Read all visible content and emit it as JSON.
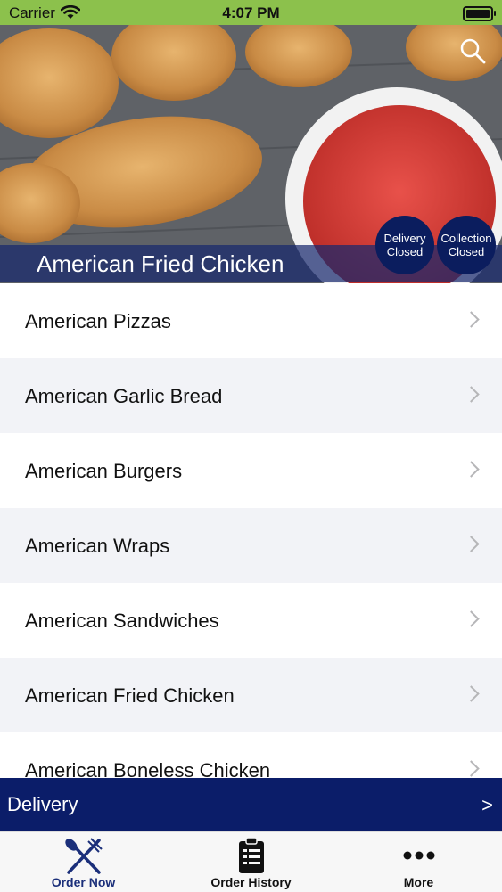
{
  "status_bar": {
    "carrier": "Carrier",
    "time": "4:07 PM"
  },
  "header": {
    "title": "American Fried Chicken",
    "badges": {
      "delivery": {
        "line1": "Delivery",
        "line2": "Closed"
      },
      "collection": {
        "line1": "Collection",
        "line2": "Closed"
      }
    }
  },
  "menu": {
    "items": [
      {
        "label": "American Pizzas"
      },
      {
        "label": "American Garlic Bread"
      },
      {
        "label": "American Burgers"
      },
      {
        "label": "American Wraps"
      },
      {
        "label": "American Sandwiches"
      },
      {
        "label": "American Fried Chicken"
      },
      {
        "label": "American Boneless Chicken"
      }
    ]
  },
  "delivery_bar": {
    "label": "Delivery",
    "arrow": ">"
  },
  "tabs": [
    {
      "label": "Order Now",
      "icon": "fork-knife-icon",
      "active": true
    },
    {
      "label": "Order History",
      "icon": "clipboard-icon",
      "active": false
    },
    {
      "label": "More",
      "icon": "more-dots-icon",
      "active": false
    }
  ],
  "colors": {
    "status_bar": "#8cc14c",
    "brand_navy": "#0b1d69",
    "row_alt": "#f2f3f7"
  }
}
